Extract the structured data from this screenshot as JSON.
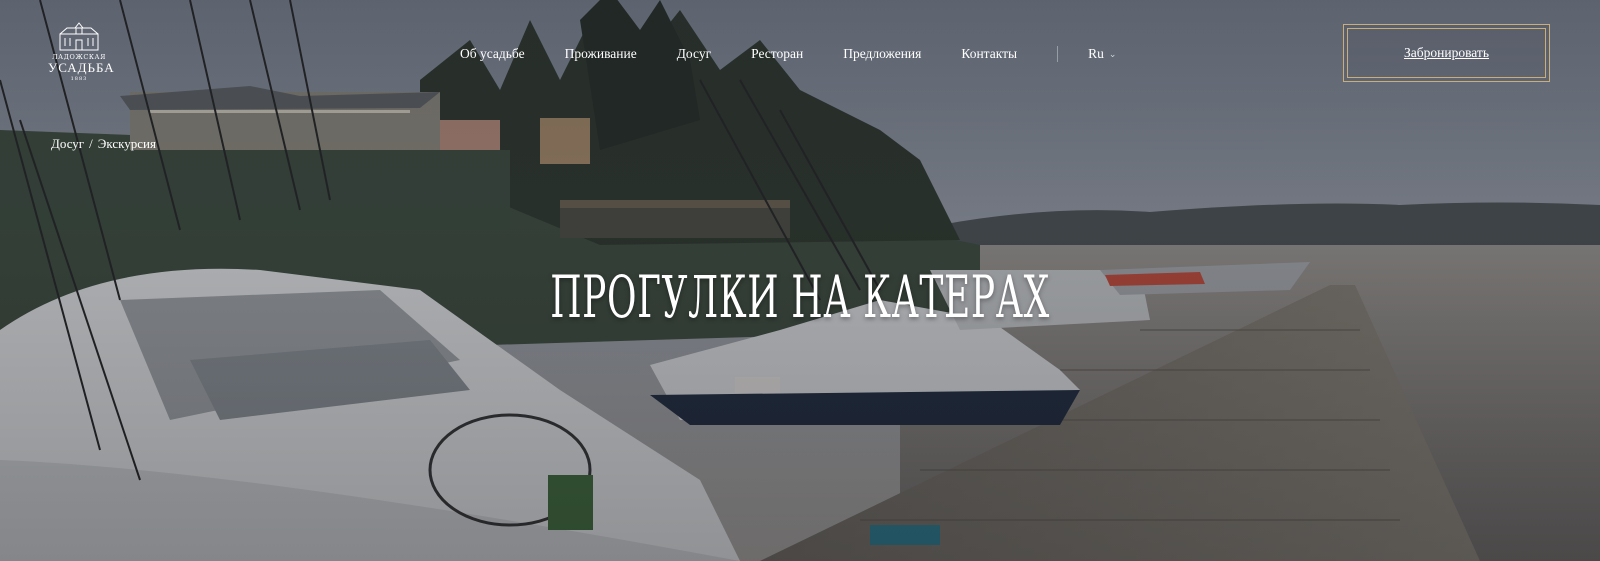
{
  "logo": {
    "line1": "ЛАДОЖСКАЯ",
    "line2": "УСАДЬБА",
    "line3": "1883"
  },
  "nav": {
    "items": [
      "Об усадьбе",
      "Проживание",
      "Досуг",
      "Ресторан",
      "Предложения",
      "Контакты"
    ],
    "language": "Ru"
  },
  "book_button": "Забронировать",
  "breadcrumb": {
    "item1": "Досуг",
    "item2": "Экскурсия"
  },
  "title": "Прогулки на катерах",
  "colors": {
    "accent_gold": "#c9ad7a",
    "overlay": "#1e222a"
  }
}
